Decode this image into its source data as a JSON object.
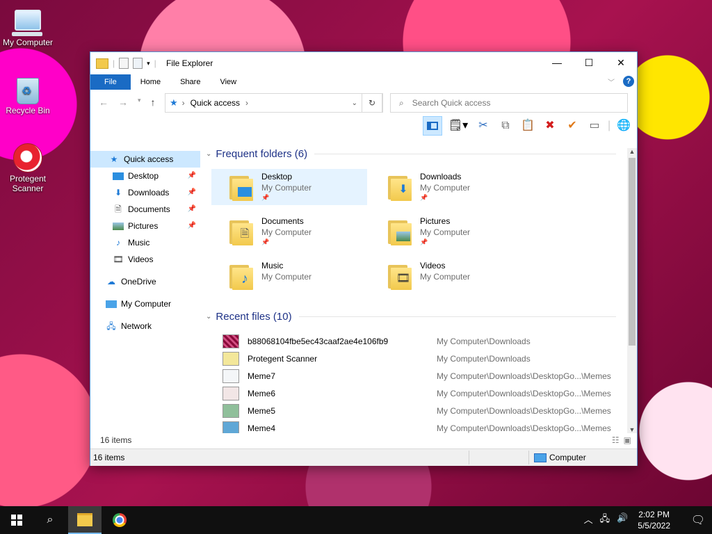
{
  "desktop": {
    "icons": [
      {
        "label": "My Computer",
        "icon": "computer-icon"
      },
      {
        "label": "Recycle Bin",
        "icon": "recycle-bin-icon"
      },
      {
        "label": "Protegent\nScanner",
        "icon": "protegent-icon"
      }
    ]
  },
  "window": {
    "title": "File Explorer",
    "tabs": {
      "file": "File",
      "home": "Home",
      "share": "Share",
      "view": "View"
    },
    "address": {
      "location": "Quick access"
    },
    "search": {
      "placeholder": "Search Quick access"
    },
    "nav": [
      {
        "label": "Quick access",
        "icon": "star-icon",
        "pinned": false,
        "active": true
      },
      {
        "label": "Desktop",
        "icon": "desktop-icon",
        "pinned": true
      },
      {
        "label": "Downloads",
        "icon": "downloads-icon",
        "pinned": true
      },
      {
        "label": "Documents",
        "icon": "documents-icon",
        "pinned": true
      },
      {
        "label": "Pictures",
        "icon": "pictures-icon",
        "pinned": true
      },
      {
        "label": "Music",
        "icon": "music-icon",
        "pinned": false
      },
      {
        "label": "Videos",
        "icon": "videos-icon",
        "pinned": false
      },
      {
        "label": "OneDrive",
        "icon": "cloud-icon",
        "pinned": false
      },
      {
        "label": "My Computer",
        "icon": "computer-icon",
        "pinned": false
      },
      {
        "label": "Network",
        "icon": "network-icon",
        "pinned": false
      }
    ],
    "frequent": {
      "heading": "Frequent folders (6)",
      "folders": [
        {
          "name": "Desktop",
          "location": "My Computer",
          "icon": "desktop-folder-icon",
          "selected": true
        },
        {
          "name": "Downloads",
          "location": "My Computer",
          "icon": "downloads-folder-icon"
        },
        {
          "name": "Documents",
          "location": "My Computer",
          "icon": "documents-folder-icon"
        },
        {
          "name": "Pictures",
          "location": "My Computer",
          "icon": "pictures-folder-icon"
        },
        {
          "name": "Music",
          "location": "My Computer",
          "icon": "music-folder-icon"
        },
        {
          "name": "Videos",
          "location": "My Computer",
          "icon": "videos-folder-icon"
        }
      ]
    },
    "recent": {
      "heading": "Recent files (10)",
      "files": [
        {
          "name": "b88068104fbe5ec43caaf2ae4e106fb9",
          "path": "My Computer\\Downloads"
        },
        {
          "name": "Protegent Scanner",
          "path": "My Computer\\Downloads"
        },
        {
          "name": "Meme7",
          "path": "My Computer\\Downloads\\DesktopGo...\\Memes"
        },
        {
          "name": "Meme6",
          "path": "My Computer\\Downloads\\DesktopGo...\\Memes"
        },
        {
          "name": "Meme5",
          "path": "My Computer\\Downloads\\DesktopGo...\\Memes"
        },
        {
          "name": "Meme4",
          "path": "My Computer\\Downloads\\DesktopGo...\\Memes"
        }
      ]
    },
    "status": {
      "item_count": "16 items",
      "computer": "Computer"
    }
  },
  "taskbar": {
    "time": "2:02 PM",
    "date": "5/5/2022"
  },
  "colors": {
    "accent": "#1a6bc4",
    "selection": "#cce8ff",
    "heading": "#1e3287"
  }
}
